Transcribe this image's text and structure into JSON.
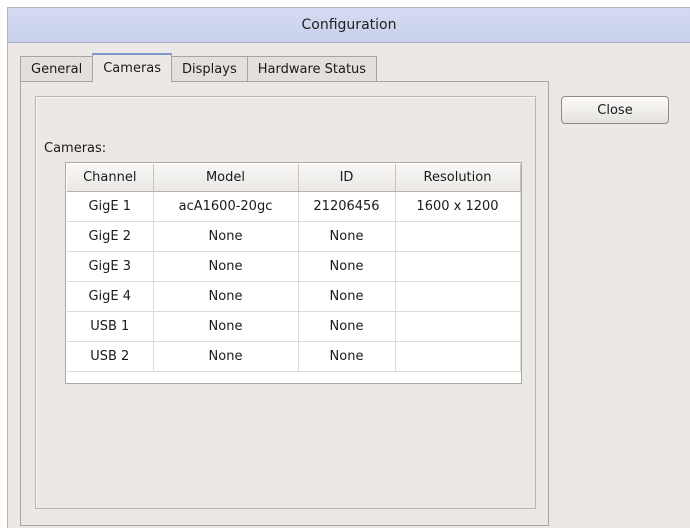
{
  "window": {
    "title": "Configuration"
  },
  "tabs": [
    {
      "label": "General"
    },
    {
      "label": "Cameras"
    },
    {
      "label": "Displays"
    },
    {
      "label": "Hardware Status"
    }
  ],
  "active_tab": "Cameras",
  "close_label": "Close",
  "cameras": {
    "group_label": "Cameras:",
    "columns": [
      "Channel",
      "Model",
      "ID",
      "Resolution"
    ],
    "rows": [
      [
        "GigE 1",
        "acA1600-20gc",
        "21206456",
        "1600 x 1200"
      ],
      [
        "GigE 2",
        "None",
        "None",
        ""
      ],
      [
        "GigE 3",
        "None",
        "None",
        ""
      ],
      [
        "GigE 4",
        "None",
        "None",
        ""
      ],
      [
        "USB 1",
        "None",
        "None",
        ""
      ],
      [
        "USB 2",
        "None",
        "None",
        ""
      ]
    ]
  }
}
